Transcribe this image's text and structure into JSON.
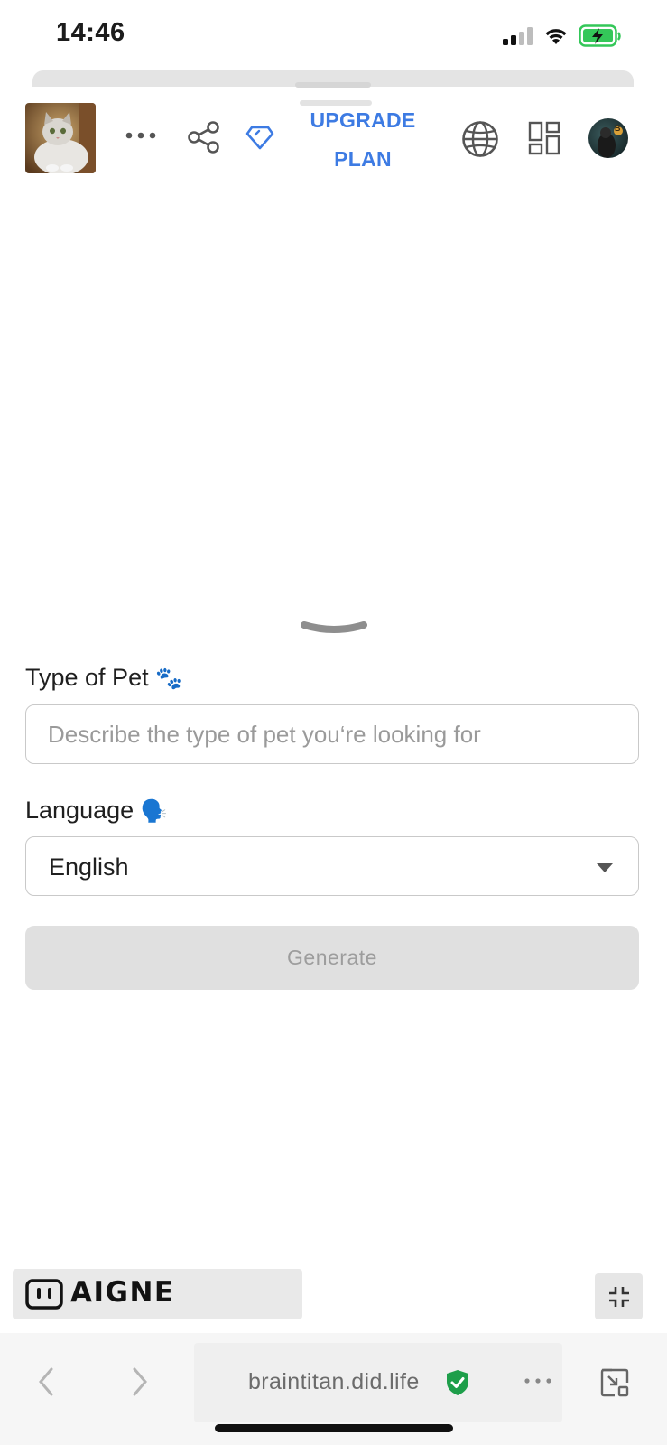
{
  "status_bar": {
    "time": "14:46",
    "signal_icon": "cellular-signal-icon",
    "wifi_icon": "wifi-icon",
    "battery_icon": "battery-charging-icon",
    "battery_color": "#34c759"
  },
  "header": {
    "app_thumbnail": "cat-thumbnail",
    "more_icon": "more-horizontal-icon",
    "share_icon": "share-icon",
    "diamond_icon": "diamond-icon",
    "upgrade_line1": "UPGRADE",
    "upgrade_line2": "PLAN",
    "globe_icon": "globe-icon",
    "apps_icon": "grid-apps-icon",
    "avatar_badge": "B",
    "accent_color": "#3d7be3"
  },
  "form": {
    "pet_type": {
      "label": "Type of Pet",
      "emoji": "🐾",
      "value": "",
      "placeholder": "Describe the type of pet you‘re looking for"
    },
    "language": {
      "label": "Language",
      "emoji": "🗣️",
      "selected": "English"
    },
    "generate_label": "Generate"
  },
  "footer": {
    "brand": "AIGNE",
    "collapse_icon": "collapse-arrows-icon"
  },
  "browser": {
    "url": "braintitan.did.life",
    "verified_icon": "shield-check-icon",
    "verified_color": "#1e9e4a"
  }
}
